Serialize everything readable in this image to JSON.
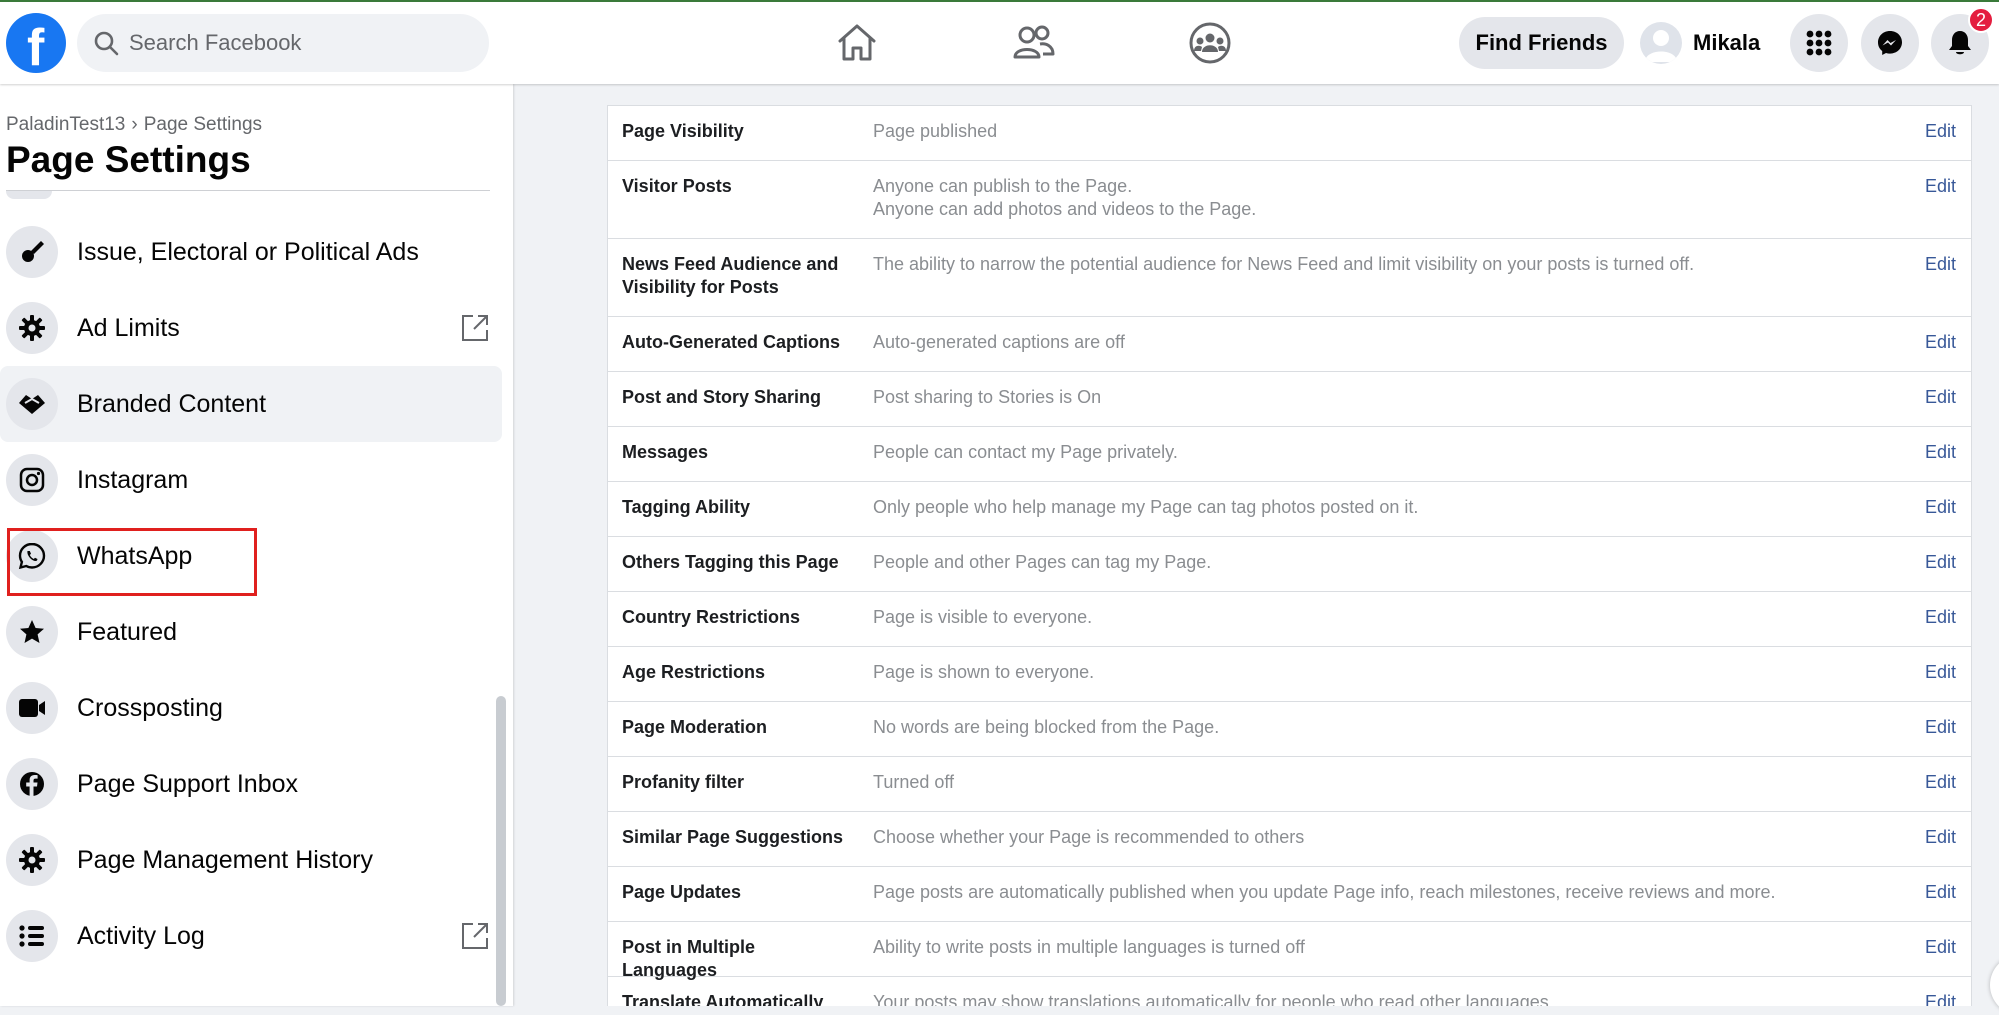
{
  "topbar": {
    "logo_letter": "f",
    "search_placeholder": "Search Facebook",
    "find_friends": "Find Friends",
    "profile_name": "Mikala",
    "notification_count": "2",
    "brand_color": "#1877f2"
  },
  "sidebar": {
    "breadcrumb_page": "PaladinTest13",
    "breadcrumb_sep": "›",
    "breadcrumb_current": "Page Settings",
    "title": "Page Settings",
    "items": [
      {
        "label": "Issue, Electoral or Political Ads",
        "icon": "megaphone-icon"
      },
      {
        "label": "Ad Limits",
        "icon": "gear-icon"
      },
      {
        "label": "Branded Content",
        "icon": "handshake-icon"
      },
      {
        "label": "Instagram",
        "icon": "instagram-icon"
      },
      {
        "label": "WhatsApp",
        "icon": "whatsapp-icon"
      },
      {
        "label": "Featured",
        "icon": "star-icon"
      },
      {
        "label": "Crossposting",
        "icon": "video-icon"
      },
      {
        "label": "Page Support Inbox",
        "icon": "facebook-icon"
      },
      {
        "label": "Page Management History",
        "icon": "gear-icon"
      },
      {
        "label": "Activity Log",
        "icon": "list-icon"
      }
    ]
  },
  "settings": {
    "edit_label": "Edit",
    "rows": [
      {
        "title": "Page Visibility",
        "value": "Page published"
      },
      {
        "title": "Visitor Posts",
        "value": "Anyone can publish to the Page.",
        "value2": "Anyone can add photos and videos to the Page."
      },
      {
        "title": "News Feed Audience and",
        "title2": "Visibility for Posts",
        "value": "The ability to narrow the potential audience for News Feed and limit visibility on your posts is turned off."
      },
      {
        "title": "Auto-Generated Captions",
        "value": "Auto-generated captions are off"
      },
      {
        "title": "Post and Story Sharing",
        "value": "Post sharing to Stories is On"
      },
      {
        "title": "Messages",
        "value": "People can contact my Page privately."
      },
      {
        "title": "Tagging Ability",
        "value": "Only people who help manage my Page can tag photos posted on it."
      },
      {
        "title": "Others Tagging this Page",
        "value": "People and other Pages can tag my Page."
      },
      {
        "title": "Country Restrictions",
        "value": "Page is visible to everyone."
      },
      {
        "title": "Age Restrictions",
        "value": "Page is shown to everyone."
      },
      {
        "title": "Page Moderation",
        "value": "No words are being blocked from the Page."
      },
      {
        "title": "Profanity filter",
        "value": "Turned off"
      },
      {
        "title": "Similar Page Suggestions",
        "value": "Choose whether your Page is recommended to others"
      },
      {
        "title": "Page Updates",
        "value": "Page posts are automatically published when you update Page info, reach milestones, receive reviews and more."
      },
      {
        "title": "Post in Multiple Languages",
        "value": "Ability to write posts in multiple languages is turned off"
      },
      {
        "title": "Translate Automatically",
        "value": "Your posts may show translations automatically for people who read other languages."
      }
    ]
  }
}
